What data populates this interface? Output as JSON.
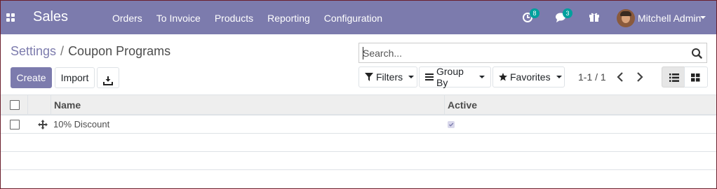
{
  "navbar": {
    "apps_icon": "grid-icon",
    "brand": "Sales",
    "menu": [
      {
        "label": "Orders"
      },
      {
        "label": "To Invoice"
      },
      {
        "label": "Products"
      },
      {
        "label": "Reporting"
      },
      {
        "label": "Configuration"
      }
    ],
    "systray": {
      "activity_count": "8",
      "messages_count": "3",
      "user_name": "Mitchell Admin"
    },
    "color": "#7c7bad",
    "badge_color": "#00a09d"
  },
  "control_panel": {
    "breadcrumb_parent": "Settings",
    "breadcrumb_separator": "/",
    "breadcrumb_current": "Coupon Programs",
    "search_placeholder": "Search...",
    "create_label": "Create",
    "import_label": "Import",
    "filters_label": "Filters",
    "group_by_label": "Group By",
    "favorites_label": "Favorites",
    "pager": "1-1 / 1"
  },
  "table": {
    "columns": [
      "Name",
      "Active"
    ],
    "rows": [
      {
        "name": "10% Discount",
        "active": true
      }
    ]
  }
}
